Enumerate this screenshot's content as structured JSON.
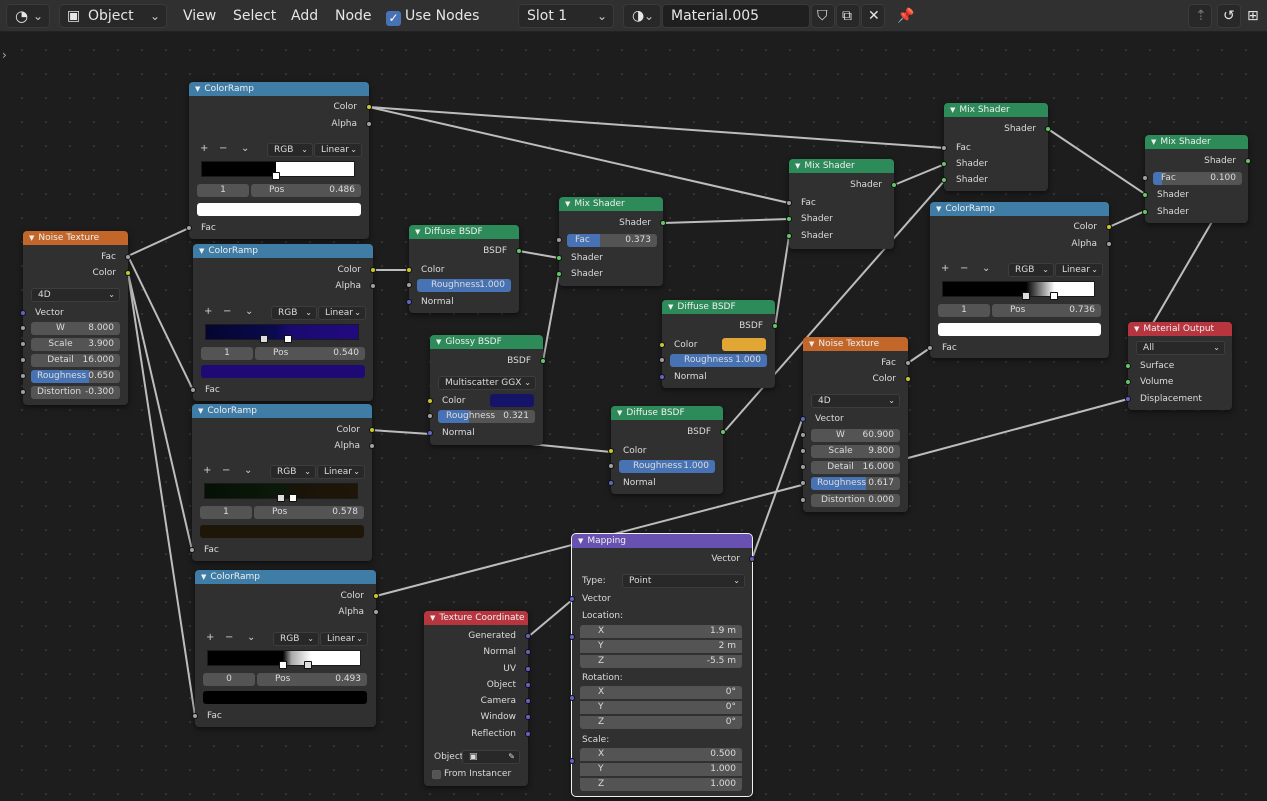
{
  "header": {
    "editor_icon": "node-editor-icon",
    "mode": "Object",
    "menus": [
      "View",
      "Select",
      "Add",
      "Node"
    ],
    "use_nodes": "Use Nodes",
    "slot": "Slot 1",
    "material_name": "Material.005"
  },
  "colors": {
    "colorramp": "#3f7da6",
    "noise": "#c26629",
    "shader": "#2d8a59",
    "output": "#b7353f",
    "vector": "#6851b0",
    "texcoord": "#b7353f"
  },
  "nodes": {
    "noise1": {
      "title": "Noise Texture",
      "out": [
        "Fac",
        "Color"
      ],
      "dim": "4D",
      "vector": "Vector",
      "fields": [
        {
          "l": "W",
          "v": "8.000"
        },
        {
          "l": "Scale",
          "v": "3.900"
        },
        {
          "l": "Detail",
          "v": "16.000"
        },
        {
          "l": "Roughness",
          "v": "0.650"
        },
        {
          "l": "Distortion",
          "v": "-0.300"
        }
      ]
    },
    "cr1": {
      "title": "ColorRamp",
      "color": "Color",
      "alpha": "Alpha",
      "mode": "RGB",
      "interp": "Linear",
      "index": "1",
      "pos_l": "Pos",
      "pos": "0.486",
      "fac": "Fac"
    },
    "cr2": {
      "title": "ColorRamp",
      "color": "Color",
      "alpha": "Alpha",
      "mode": "RGB",
      "interp": "Linear",
      "index": "1",
      "pos_l": "Pos",
      "pos": "0.540",
      "fac": "Fac"
    },
    "cr3": {
      "title": "ColorRamp",
      "color": "Color",
      "alpha": "Alpha",
      "mode": "RGB",
      "interp": "Linear",
      "index": "1",
      "pos_l": "Pos",
      "pos": "0.578",
      "fac": "Fac"
    },
    "cr4": {
      "title": "ColorRamp",
      "color": "Color",
      "alpha": "Alpha",
      "mode": "RGB",
      "interp": "Linear",
      "index": "0",
      "pos_l": "Pos",
      "pos": "0.493",
      "fac": "Fac"
    },
    "cr5": {
      "title": "ColorRamp",
      "color": "Color",
      "alpha": "Alpha",
      "mode": "RGB",
      "interp": "Linear",
      "index": "1",
      "pos_l": "Pos",
      "pos": "0.736",
      "fac": "Fac"
    },
    "diff1": {
      "title": "Diffuse BSDF",
      "out": "BSDF",
      "color": "Color",
      "rough_l": "Roughness",
      "rough": "1.000",
      "normal": "Normal"
    },
    "diff2": {
      "title": "Diffuse BSDF",
      "out": "BSDF",
      "color": "Color",
      "rough_l": "Roughness",
      "rough": "1.000",
      "normal": "Normal"
    },
    "diff3": {
      "title": "Diffuse BSDF",
      "out": "BSDF",
      "color": "Color",
      "rough_l": "Roughness",
      "rough": "1.000",
      "normal": "Normal"
    },
    "glossy": {
      "title": "Glossy BSDF",
      "out": "BSDF",
      "dist": "Multiscatter GGX",
      "color": "Color",
      "rough_l": "Roughness",
      "rough": "0.321",
      "normal": "Normal"
    },
    "mix1": {
      "title": "Mix Shader",
      "out": "Shader",
      "fac_l": "Fac",
      "fac": "0.373",
      "s1": "Shader",
      "s2": "Shader"
    },
    "mix2": {
      "title": "Mix Shader",
      "out": "Shader",
      "fac_l": "Fac",
      "s1": "Shader",
      "s2": "Shader"
    },
    "mix3": {
      "title": "Mix Shader",
      "out": "Shader",
      "fac_l": "Fac",
      "s1": "Shader",
      "s2": "Shader"
    },
    "mix4": {
      "title": "Mix Shader",
      "out": "Shader",
      "fac_l": "Fac",
      "fac": "0.100",
      "s1": "Shader",
      "s2": "Shader"
    },
    "noise2": {
      "title": "Noise Texture",
      "out": [
        "Fac",
        "Color"
      ],
      "dim": "4D",
      "vector": "Vector",
      "fields": [
        {
          "l": "W",
          "v": "60.900"
        },
        {
          "l": "Scale",
          "v": "9.800"
        },
        {
          "l": "Detail",
          "v": "16.000"
        },
        {
          "l": "Roughness",
          "v": "0.617"
        },
        {
          "l": "Distortion",
          "v": "0.000"
        }
      ]
    },
    "output": {
      "title": "Material Output",
      "target": "All",
      "inputs": [
        "Surface",
        "Volume",
        "Displacement"
      ]
    },
    "mapping": {
      "title": "Mapping",
      "out": "Vector",
      "type_l": "Type:",
      "type": "Point",
      "vector": "Vector",
      "loc_l": "Location:",
      "loc": [
        {
          "l": "X",
          "v": "1.9 m"
        },
        {
          "l": "Y",
          "v": "2 m"
        },
        {
          "l": "Z",
          "v": "-5.5 m"
        }
      ],
      "rot_l": "Rotation:",
      "rot": [
        {
          "l": "X",
          "v": "0°"
        },
        {
          "l": "Y",
          "v": "0°"
        },
        {
          "l": "Z",
          "v": "0°"
        }
      ],
      "scale_l": "Scale:",
      "scale": [
        {
          "l": "X",
          "v": "0.500"
        },
        {
          "l": "Y",
          "v": "1.000"
        },
        {
          "l": "Z",
          "v": "1.000"
        }
      ]
    },
    "texcoord": {
      "title": "Texture Coordinate",
      "outs": [
        "Generated",
        "Normal",
        "UV",
        "Object",
        "Camera",
        "Window",
        "Reflection"
      ],
      "object_l": "Object:",
      "from_instancer": "From Instancer"
    }
  }
}
